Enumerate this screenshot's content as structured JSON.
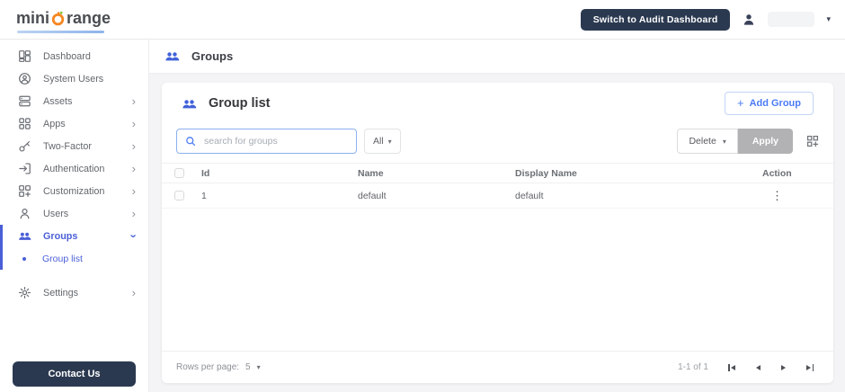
{
  "topbar": {
    "logo_part1": "mini",
    "logo_part2": "range",
    "logo_o_icon": "orange-ring-icon",
    "switch_button": "Switch to Audit Dashboard",
    "user_icon": "user-avatar-icon",
    "user_caret": "▾"
  },
  "sidebar": {
    "items": [
      {
        "label": "Dashboard",
        "icon": "dashboard-icon",
        "expandable": false
      },
      {
        "label": "System Users",
        "icon": "system-users-icon",
        "expandable": false
      },
      {
        "label": "Assets",
        "icon": "assets-icon",
        "expandable": true
      },
      {
        "label": "Apps",
        "icon": "apps-icon",
        "expandable": true
      },
      {
        "label": "Two-Factor",
        "icon": "two-factor-icon",
        "expandable": true
      },
      {
        "label": "Authentication",
        "icon": "authentication-icon",
        "expandable": true
      },
      {
        "label": "Customization",
        "icon": "customization-icon",
        "expandable": true
      },
      {
        "label": "Users",
        "icon": "users-icon",
        "expandable": true
      },
      {
        "label": "Groups",
        "icon": "groups-icon",
        "expandable": true,
        "expanded": true,
        "active": true
      },
      {
        "label": "Group list",
        "icon": "bullet-dot",
        "sub": true,
        "active": true
      },
      {
        "label": "Settings",
        "icon": "settings-icon",
        "expandable": true,
        "gap_before": true
      }
    ],
    "contact_button": "Contact Us"
  },
  "page": {
    "title": "Groups",
    "title_icon": "groups-icon"
  },
  "card": {
    "title": "Group list",
    "title_icon": "groups-icon",
    "add_button_label": "Add Group",
    "search_placeholder": "search for groups",
    "filter_all_label": "All",
    "delete_button_label": "Delete",
    "apply_button_label": "Apply",
    "table": {
      "columns": [
        "Id",
        "Name",
        "Display Name",
        "Action"
      ],
      "rows": [
        {
          "id": "1",
          "name": "default",
          "display_name": "default"
        }
      ]
    },
    "footer": {
      "rows_per_page_label": "Rows per page:",
      "rows_per_page_value": "5",
      "range_label": "1-1 of 1"
    }
  },
  "colors": {
    "accent": "#4a5fd6",
    "icon_blue": "#4161d9",
    "link_blue": "#4a7bf5",
    "navy": "#2b3950",
    "orange": "#f6851f",
    "leaf_green": "#8dc63f",
    "apply_gray": "#b2b2b4"
  }
}
